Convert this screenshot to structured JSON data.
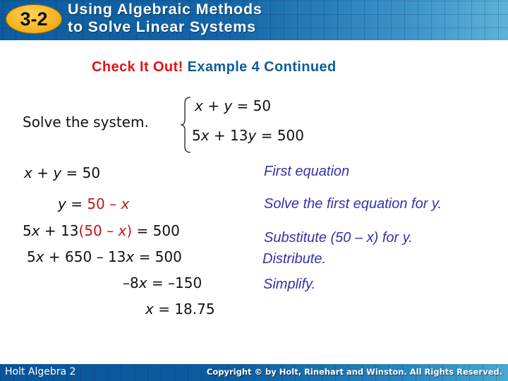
{
  "header": {
    "lesson_number": "3-2",
    "title_line1": "Using Algebraic Methods",
    "title_line2": "to Solve Linear Systems"
  },
  "subtitle": {
    "highlight": "Check It Out!",
    "rest": "Example 4 Continued"
  },
  "prompt": {
    "text": "Solve the system.",
    "system": [
      {
        "parts": [
          "x",
          " + ",
          "y",
          " = 50"
        ]
      },
      {
        "parts": [
          "5",
          "x",
          " + 13",
          "y",
          " = 500"
        ]
      }
    ]
  },
  "steps": [
    {
      "math": "x + y = 50",
      "note": "First equation"
    },
    {
      "math": "y = 50 – x",
      "note": "Solve the first equation for y."
    },
    {
      "math": "5x + 13(50 – x) = 500",
      "note": "Substitute (50 – x) for y."
    },
    {
      "math": "5x + 650 – 13x = 500",
      "note": "Distribute."
    },
    {
      "math": "–8x = –150",
      "note": "Simplify."
    },
    {
      "math": "x = 18.75",
      "note": ""
    }
  ],
  "tokens": {
    "x": "x",
    "y": "y",
    "eq50": " = 50",
    "plus": " + ",
    "y_eq": " = ",
    "fifty_minus": "50 – ",
    "five": "5",
    "thirteen_open": " + 13(",
    "close_eq500": ") = 500",
    "plus650minus13": " + 650 – 13",
    "eq500": " = 500",
    "neg8": "–8",
    "eq_neg150": " = –150",
    "eq1875": " = 18.75",
    "plus13": " + 13"
  },
  "footer": {
    "left": "Holt Algebra 2",
    "right": "Copyright © by Holt, Rinehart and Winston. All Rights Reserved."
  },
  "colors": {
    "header_blue": "#0d5c9e",
    "badge_orange": "#f6b21f",
    "subtitle_red": "#e3121a",
    "subtitle_blue": "#0f5e93",
    "substitution_red": "#c0161c",
    "note_blue": "#3333aa"
  }
}
